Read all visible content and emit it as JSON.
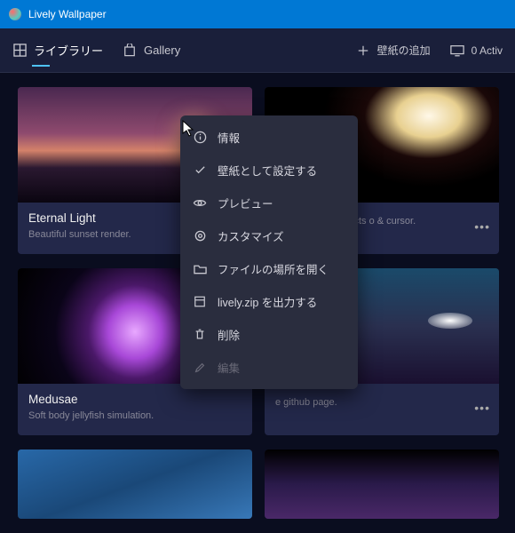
{
  "app": {
    "title": "Lively Wallpaper"
  },
  "toolbar": {
    "tabs": [
      {
        "label": "ライブラリー"
      },
      {
        "label": "Gallery"
      }
    ],
    "add_label": "壁紙の追加",
    "active_label": "0 Activ"
  },
  "cards": [
    {
      "title": "Eternal Light",
      "desc": "Beautiful sunset render."
    },
    {
      "title": "",
      "desc": "using WebGL, reacts o & cursor."
    },
    {
      "title": "Medusae",
      "desc": "Soft body jellyfish simulation."
    },
    {
      "title": "",
      "desc": "e github page."
    }
  ],
  "menu": {
    "items": [
      {
        "label": "情報"
      },
      {
        "label": "壁紙として設定する"
      },
      {
        "label": "プレビュー"
      },
      {
        "label": "カスタマイズ"
      },
      {
        "label": "ファイルの場所を開く"
      },
      {
        "label": "lively.zip を出力する"
      },
      {
        "label": "削除"
      },
      {
        "label": "編集"
      }
    ]
  }
}
